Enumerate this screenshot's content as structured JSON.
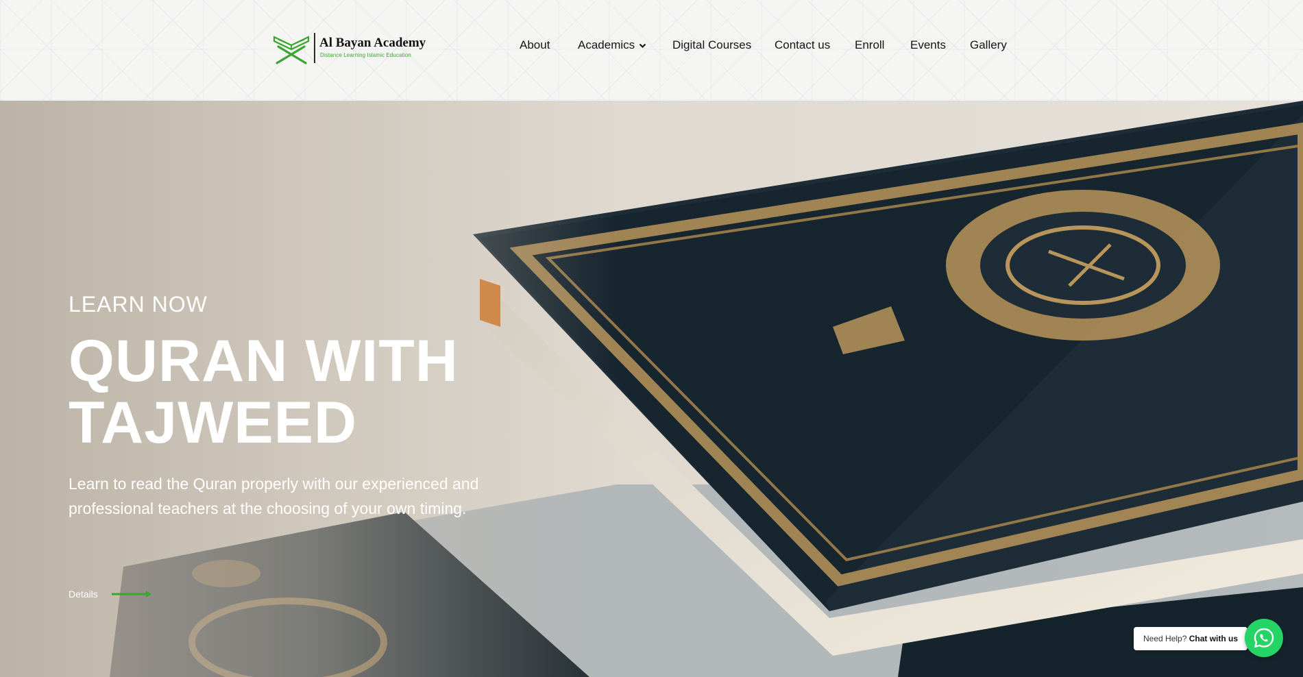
{
  "brand": {
    "name": "Al Bayan Academy",
    "tagline": "Distance Learning Islamic Education",
    "accent_color": "#3aa52f"
  },
  "nav": {
    "items": [
      {
        "label": "About"
      },
      {
        "label": "Academics",
        "has_dropdown": true
      },
      {
        "label": "Digital Courses"
      },
      {
        "label": "Contact us"
      },
      {
        "label": "Enroll"
      },
      {
        "label": "Events"
      },
      {
        "label": "Gallery"
      }
    ]
  },
  "hero": {
    "eyebrow": "LEARN NOW",
    "headline": "QURAN WITH TAJWEED",
    "subtext": "Learn to read the Quran properly with our experienced and professional teachers at the choosing of your own timing.",
    "cta_label": "Details",
    "cta_icon": "arrow-right-icon"
  },
  "chat_widget": {
    "prompt": "Need Help?",
    "action": "Chat with us",
    "icon": "whatsapp-icon",
    "color": "#25d366"
  }
}
